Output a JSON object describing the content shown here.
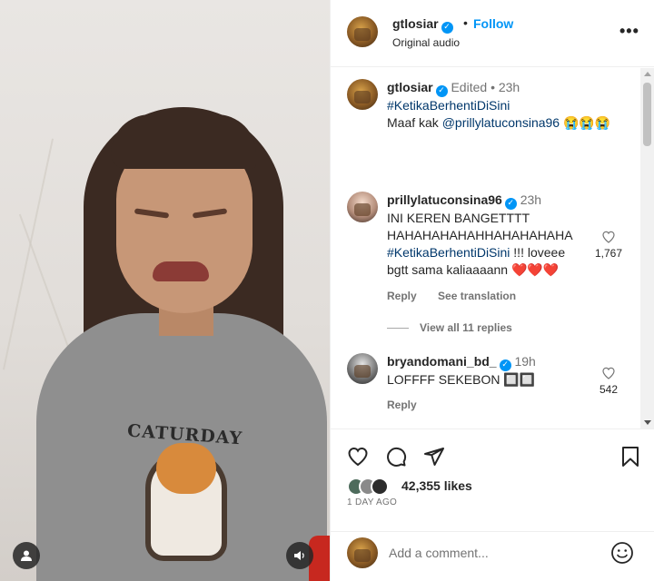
{
  "post": {
    "username": "gtlosiar",
    "follow_label": "Follow",
    "audio_label": "Original audio",
    "dot": "•",
    "more": "•••"
  },
  "caption": {
    "username": "gtlosiar",
    "edited": "Edited",
    "time": "23h",
    "hashtag": "#KetikaBerhentiDiSini",
    "line2_prefix": "Maaf kak ",
    "mention": "@prillylatuconsina96",
    "emoji": "😭😭😭"
  },
  "comments": [
    {
      "username": "prillylatuconsina96",
      "time": "23h",
      "text": "INI KEREN BANGETTTT HAHAHAHAHAHHAHAHAHAHA",
      "hashtag": "#KetikaBerhentiDiSini",
      "text_after": " !!! loveee bgtt sama kaliaaaann ",
      "hearts": "❤️❤️❤️",
      "likes": "1,767",
      "reply_label": "Reply",
      "translate_label": "See translation"
    },
    {
      "username": "bryandomani_bd_",
      "time": "19h",
      "text": "LOFFFF SEKEBON 🔲🔲",
      "likes": "542",
      "reply_label": "Reply"
    }
  ],
  "view_replies": "View all 11 replies",
  "likes_text": "42,355 likes",
  "time_ago": "1 DAY AGO",
  "add_comment_placeholder": "Add a comment...",
  "media": {
    "shirt_text": "CATURDAY"
  },
  "icons": {
    "like": "heart-icon",
    "comment": "comment-icon",
    "share": "send-icon",
    "save": "bookmark-icon",
    "emoji": "smiley-icon",
    "audio": "speaker-icon",
    "user": "user-icon"
  },
  "colors": {
    "accent": "#0095f6",
    "text": "#262626",
    "muted": "#737373",
    "mention": "#00376b"
  }
}
